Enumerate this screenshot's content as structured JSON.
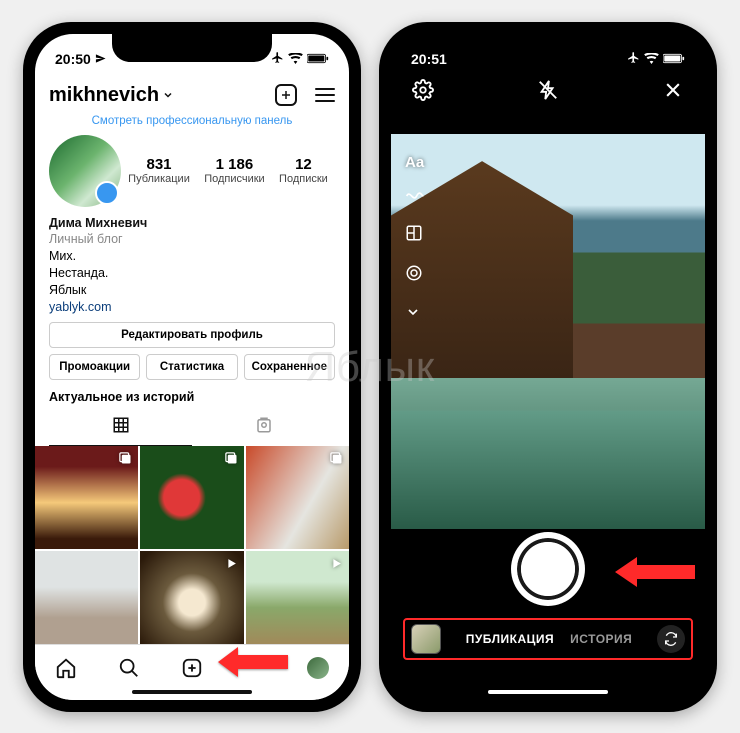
{
  "leftPhone": {
    "statusbar": {
      "time": "20:50"
    },
    "header": {
      "username": "mikhnevich"
    },
    "proLink": "Смотреть профессиональную панель",
    "stats": {
      "posts": {
        "num": "831",
        "label": "Публикации"
      },
      "followers": {
        "num": "1 186",
        "label": "Подписчики"
      },
      "following": {
        "num": "12",
        "label": "Подписки"
      }
    },
    "bio": {
      "name": "Дима Михневич",
      "category": "Личный блог",
      "line1": "Мих.",
      "line2": "Нестанда.",
      "line3": "Яблык",
      "link": "yablyk.com"
    },
    "buttons": {
      "edit": "Редактировать профиль",
      "promo": "Промоакции",
      "stats": "Статистика",
      "saved": "Сохраненное"
    },
    "storiesLabel": "Актуальное из историй"
  },
  "rightPhone": {
    "statusbar": {
      "time": "20:51"
    },
    "sideTools": {
      "text": "Aa"
    },
    "modes": {
      "publication": "ПУБЛИКАЦИЯ",
      "story": "ИСТОРИЯ"
    }
  },
  "watermark": "Яблык"
}
